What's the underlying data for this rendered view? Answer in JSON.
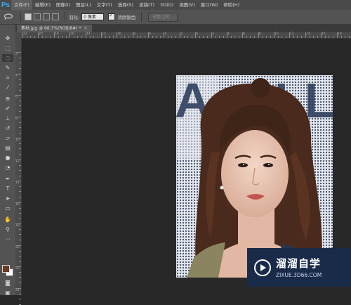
{
  "app": {
    "logo": "Ps"
  },
  "menu": [
    "文件(F)",
    "编辑(E)",
    "图像(I)",
    "图层(L)",
    "文字(Y)",
    "选择(S)",
    "滤镜(T)",
    "3D(D)",
    "视图(V)",
    "窗口(W)",
    "帮助(H)"
  ],
  "options": {
    "tool_icon": "lasso-icon",
    "feather_label": "羽化:",
    "feather_value": "0 像素",
    "antialias_label": "消除锯齿",
    "antialias_checked": true,
    "refine_edge_label": "调整边缘..."
  },
  "document": {
    "tab_label": "素材.jpg @ 66.7%(RGB/8#) *",
    "close_glyph": "×"
  },
  "ruler": {
    "top_numbers": [
      "22",
      "20",
      "18",
      "16",
      "14",
      "12",
      "10",
      "8",
      "6",
      "4",
      "2",
      "0",
      "2",
      "4",
      "6",
      "8",
      "10",
      "12",
      "14",
      "16",
      "18"
    ],
    "left_numbers": [
      "2",
      "4",
      "6",
      "8",
      "10",
      "12",
      "14",
      "16",
      "18",
      "20",
      "22",
      "24"
    ]
  },
  "colors": {
    "foreground": "#6b3a24",
    "background": "#ffffff",
    "accent": "#39a9f4"
  },
  "tools": [
    "move-tool",
    "marquee-tool",
    "lasso-tool",
    "quick-select-tool",
    "crop-tool",
    "eyedropper-tool",
    "healing-brush-tool",
    "brush-tool",
    "clone-stamp-tool",
    "history-brush-tool",
    "eraser-tool",
    "gradient-tool",
    "blur-tool",
    "dodge-tool",
    "pen-tool",
    "type-tool",
    "path-select-tool",
    "shape-tool",
    "hand-tool",
    "zoom-tool"
  ],
  "watermark": {
    "title": "溜溜自学",
    "url": "ZIXUE.3D66.COM"
  }
}
